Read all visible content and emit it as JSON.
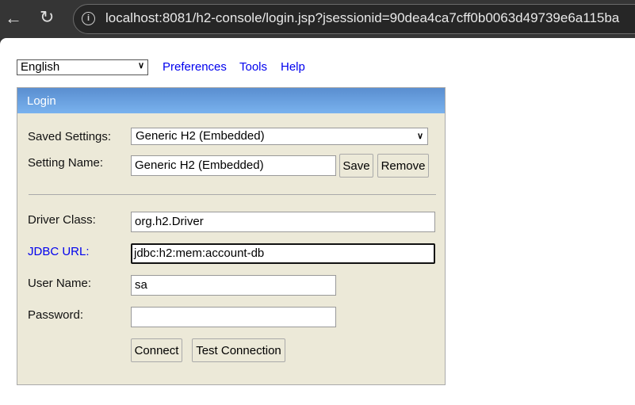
{
  "browser": {
    "url": "localhost:8081/h2-console/login.jsp?jsessionid=90dea4ca7cff0b0063d49739e6a115ba"
  },
  "topnav": {
    "language": "English",
    "links": [
      "Preferences",
      "Tools",
      "Help"
    ]
  },
  "login": {
    "title": "Login",
    "saved_settings_label": "Saved Settings:",
    "saved_settings_value": "Generic H2 (Embedded)",
    "setting_name_label": "Setting Name:",
    "setting_name_value": "Generic H2 (Embedded)",
    "save_label": "Save",
    "remove_label": "Remove",
    "driver_class_label": "Driver Class:",
    "driver_class_value": "org.h2.Driver",
    "jdbc_url_label": "JDBC URL:",
    "jdbc_url_value": "jdbc:h2:mem:account-db",
    "user_name_label": "User Name:",
    "user_name_value": "sa",
    "password_label": "Password:",
    "password_value": "",
    "connect_label": "Connect",
    "test_connection_label": "Test Connection"
  },
  "colors": {
    "link": "#0000ee",
    "panel_bg": "#ece9d8",
    "header_blue": "#6a9fe0"
  }
}
